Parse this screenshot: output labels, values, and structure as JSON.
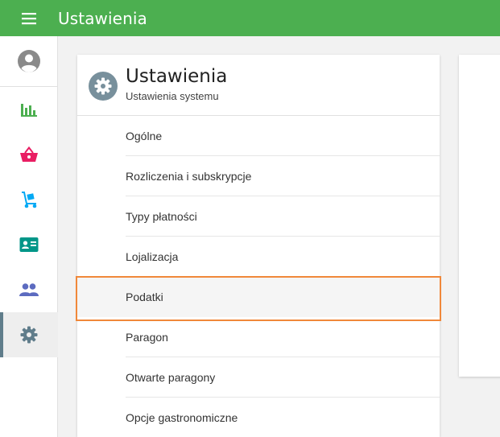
{
  "appbar": {
    "title": "Ustawienia",
    "background": "#4caf50",
    "menu_icon": "hamburger-menu-icon"
  },
  "sidebar": {
    "items": [
      {
        "name": "account",
        "icon": "account-circle-icon",
        "color": "#8a8a8a"
      },
      {
        "name": "reports",
        "icon": "bar-chart-icon",
        "color": "#4caf50"
      },
      {
        "name": "sales",
        "icon": "shopping-basket-icon",
        "color": "#e91e63"
      },
      {
        "name": "inventory",
        "icon": "hand-truck-icon",
        "color": "#03a9f4"
      },
      {
        "name": "contacts",
        "icon": "contact-card-icon",
        "color": "#009688"
      },
      {
        "name": "users",
        "icon": "people-icon",
        "color": "#5c6bc0"
      },
      {
        "name": "settings",
        "icon": "gear-icon",
        "color": "#607d8b",
        "active": true
      }
    ]
  },
  "panel": {
    "title": "Ustawienia",
    "subtitle": "Ustawienia systemu",
    "icon": "gear-icon",
    "items": [
      {
        "label": "Ogólne"
      },
      {
        "label": "Rozliczenia i subskrypcje"
      },
      {
        "label": "Typy płatności"
      },
      {
        "label": "Lojalizacja"
      },
      {
        "label": "Podatki",
        "selected": true
      },
      {
        "label": "Paragon"
      },
      {
        "label": "Otwarte paragony"
      },
      {
        "label": "Opcje gastronomiczne"
      }
    ]
  },
  "colors": {
    "accent": "#4caf50",
    "highlight": "#f0883a"
  }
}
